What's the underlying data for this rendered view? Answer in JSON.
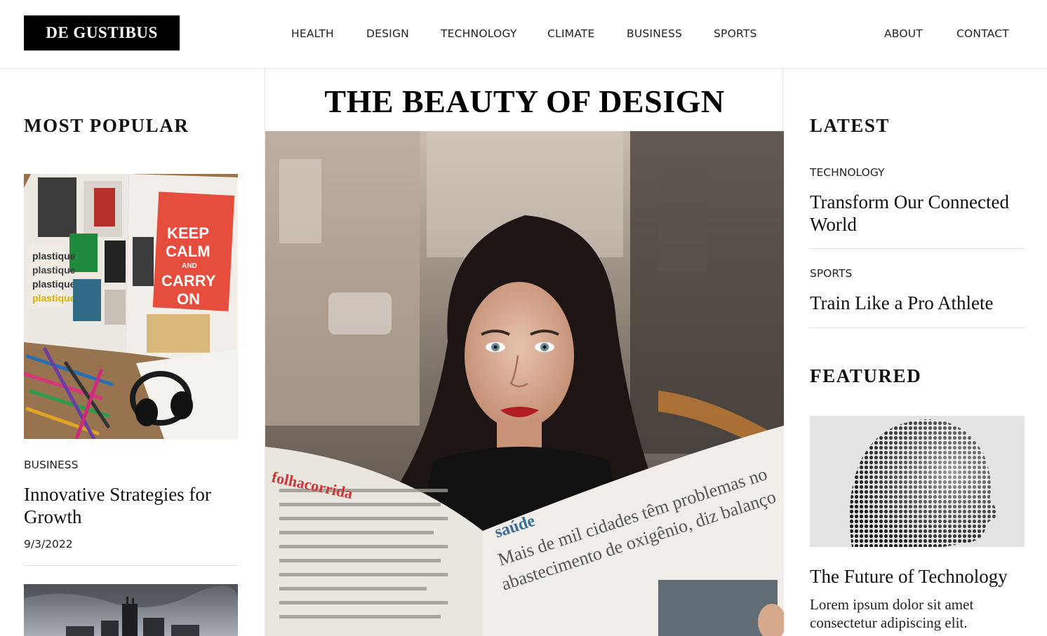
{
  "header": {
    "logo": "DE GUSTIBUS",
    "nav": [
      "HEALTH",
      "DESIGN",
      "TECHNOLOGY",
      "CLIMATE",
      "BUSINESS",
      "SPORTS"
    ],
    "nav_right": [
      "ABOUT",
      "CONTACT"
    ]
  },
  "left": {
    "section_title": "MOST POPULAR",
    "article": {
      "category": "BUSINESS",
      "title": "Innovative Strategies for Growth",
      "date": "9/3/2022"
    }
  },
  "main": {
    "title": "THE BEAUTY OF DESIGN"
  },
  "right": {
    "latest_title": "LATEST",
    "latest": [
      {
        "category": "TECHNOLOGY",
        "title": "Transform Our Connected World"
      },
      {
        "category": "SPORTS",
        "title": "Train Like a Pro Athlete"
      }
    ],
    "featured_title": "FEATURED",
    "featured": {
      "title": "The Future of Technology",
      "excerpt": "Lorem ipsum dolor sit amet consectetur adipiscing elit."
    }
  }
}
